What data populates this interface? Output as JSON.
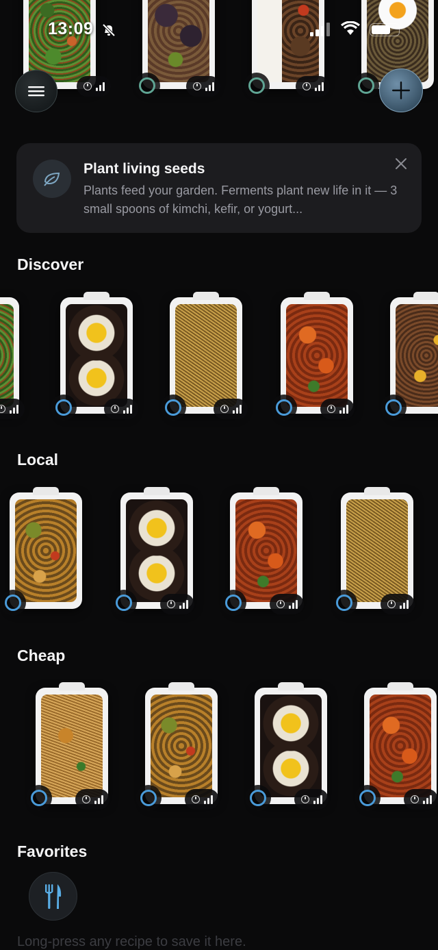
{
  "status_bar": {
    "time": "13:09"
  },
  "banner": {
    "title": "Plant living seeds",
    "body": "Plants feed your garden. Ferments plant new life in it — 3 small spoons of kimchi, kefir, or yogurt..."
  },
  "sections": {
    "discover": "Discover",
    "local": "Local",
    "cheap": "Cheap",
    "favorites": "Favorites"
  },
  "favorites_hint": "Long-press any recipe to save it here.",
  "colors": {
    "accent_ring": "#4a9bd9",
    "accent_ring_green": "#5fa493",
    "background": "#0a0a0b",
    "banner_bg": "#1c1c1f"
  },
  "icons": [
    "menu-icon",
    "plus-icon",
    "leaf-icon",
    "close-icon",
    "clock-icon",
    "difficulty-bars-icon",
    "fork-knife-icon",
    "bell-slash-icon",
    "wifi-icon",
    "battery-icon",
    "signal-icon"
  ]
}
